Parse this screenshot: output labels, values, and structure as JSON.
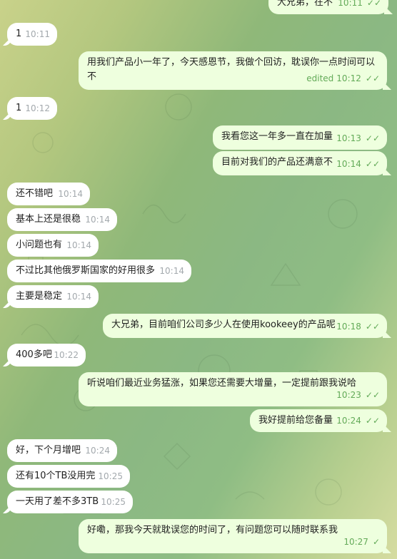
{
  "messages": [
    {
      "side": "out",
      "text": "大兄弟，在不",
      "time": "10:11",
      "ticks": "double"
    },
    {
      "side": "in",
      "text": "1",
      "time": "10:11"
    },
    {
      "side": "out",
      "text": "用我们产品小一年了，今天感恩节，我做个回访，耽误你一点时间可以不",
      "time": "10:12",
      "edited": "edited",
      "ticks": "double"
    },
    {
      "side": "in",
      "text": "1",
      "time": "10:12"
    },
    {
      "side": "out",
      "text": "我看您这一年多一直在加量",
      "time": "10:13",
      "ticks": "double"
    },
    {
      "side": "out",
      "text": "目前对我们的产品还满意不",
      "time": "10:14",
      "ticks": "double"
    },
    {
      "side": "in",
      "text": "还不错吧",
      "time": "10:14"
    },
    {
      "side": "in",
      "text": "基本上还是很稳",
      "time": "10:14"
    },
    {
      "side": "in",
      "text": "小问题也有",
      "time": "10:14"
    },
    {
      "side": "in",
      "text": "不过比其他俄罗斯国家的好用很多",
      "time": "10:14"
    },
    {
      "side": "in",
      "text": "主要是稳定",
      "time": "10:14"
    },
    {
      "side": "out",
      "text": "大兄弟，目前咱们公司多少人在使用kookeey的产品呢",
      "time": "10:18",
      "ticks": "double"
    },
    {
      "side": "in",
      "text": "400多吧",
      "time": "10:22"
    },
    {
      "side": "out",
      "text": "听说咱们最近业务猛涨，如果您还需要大增量，一定提前跟我说哈",
      "time": "10:23",
      "ticks": "double"
    },
    {
      "side": "out",
      "text": "我好提前给您备量",
      "time": "10:24",
      "ticks": "double"
    },
    {
      "side": "in",
      "text": "好，下个月增吧",
      "time": "10:24"
    },
    {
      "side": "in",
      "text": "还有10个TB没用完",
      "time": "10:25"
    },
    {
      "side": "in",
      "text": "一天用了差不多3TB",
      "time": "10:25"
    },
    {
      "side": "out",
      "text": "好嘞，那我今天就耽误您的时间了，有问题您可以随时联系我",
      "time": "10:27",
      "ticks": "single"
    }
  ]
}
